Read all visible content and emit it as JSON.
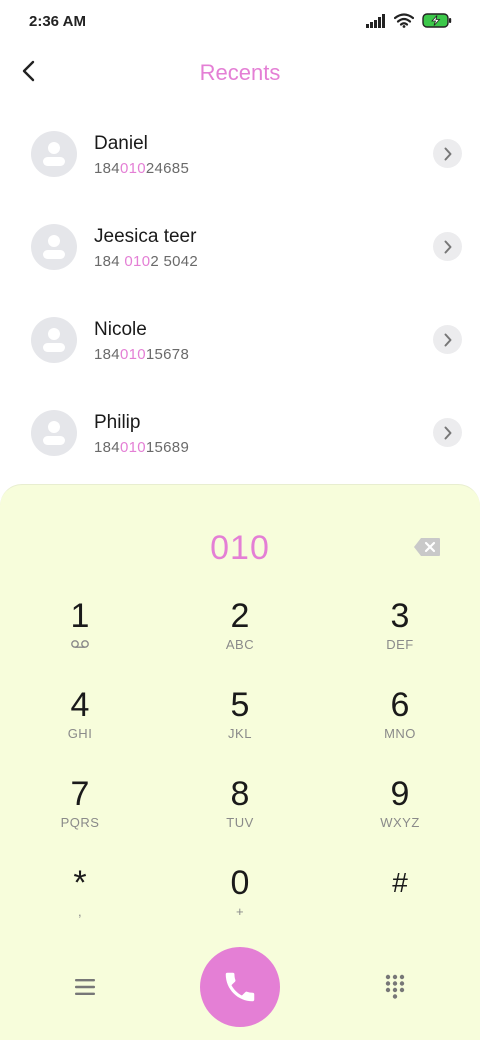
{
  "status_bar": {
    "time": "2:36 AM"
  },
  "header": {
    "title": "Recents"
  },
  "contacts": [
    {
      "name": "Daniel",
      "number_pre": "184",
      "number_match": "010",
      "number_post": "24685"
    },
    {
      "name": "Jeesica teer",
      "number_pre": "184 ",
      "number_match": "010",
      "number_post": "2 5042"
    },
    {
      "name": "Nicole",
      "number_pre": "184",
      "number_match": "010",
      "number_post": "15678"
    },
    {
      "name": "Philip",
      "number_pre": "184",
      "number_match": "010",
      "number_post": "15689"
    }
  ],
  "dialer": {
    "dialed": "010",
    "keys": [
      {
        "digit": "1",
        "letters": ""
      },
      {
        "digit": "2",
        "letters": "ABC"
      },
      {
        "digit": "3",
        "letters": "DEF"
      },
      {
        "digit": "4",
        "letters": "GHI"
      },
      {
        "digit": "5",
        "letters": "JKL"
      },
      {
        "digit": "6",
        "letters": "MNO"
      },
      {
        "digit": "7",
        "letters": "PQRS"
      },
      {
        "digit": "8",
        "letters": "TUV"
      },
      {
        "digit": "9",
        "letters": "WXYZ"
      },
      {
        "digit": "*",
        "letters": ","
      },
      {
        "digit": "0",
        "letters": "+"
      },
      {
        "digit": "#",
        "letters": ""
      }
    ]
  },
  "icons": {
    "back": "chevron-left-icon",
    "detail": "chevron-right-icon",
    "backspace": "backspace-icon",
    "voicemail": "voicemail-icon",
    "menu": "menu-icon",
    "call": "phone-icon",
    "keypad": "dialpad-icon"
  },
  "colors": {
    "accent": "#e47fd5",
    "dial_panel_bg": "#f7fddb",
    "avatar_bg": "#e5e6ea",
    "battery": "#3cc84a"
  }
}
